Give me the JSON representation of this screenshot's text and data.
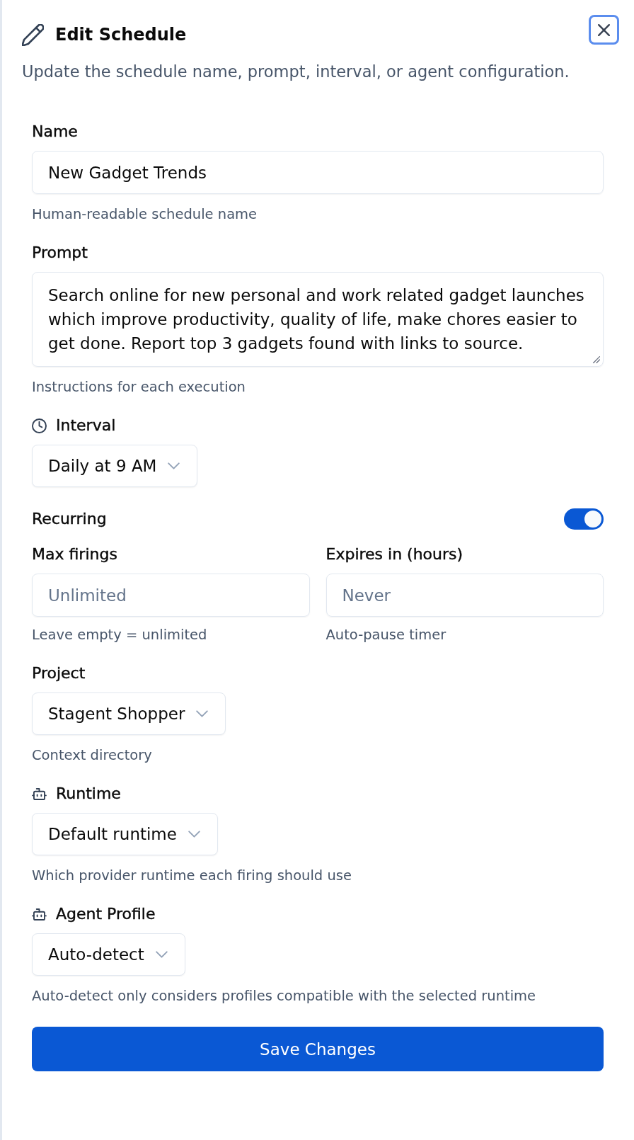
{
  "dialog": {
    "title": "Edit Schedule",
    "subtitle": "Update the schedule name, prompt, interval, or agent configuration."
  },
  "fields": [
    {
      "kind": "text",
      "label": "Name",
      "value": "New Gadget Trends",
      "hint": "Human-readable schedule name"
    },
    {
      "kind": "textarea",
      "label": "Prompt",
      "value": "Search online for new personal and work related gadget launches which improve productivity, quality of life, make chores easier to get done. Report top 3 gadgets found with links to source.",
      "hint": "Instructions for each execution"
    },
    {
      "kind": "interval",
      "label": "Interval",
      "value": "Daily at 9 AM"
    },
    {
      "kind": "toggle",
      "label": "Recurring",
      "on": true
    },
    {
      "kind": "pair",
      "items": [
        {
          "label": "Max firings",
          "placeholder": "Unlimited",
          "hint": "Leave empty = unlimited"
        },
        {
          "label": "Expires in (hours)",
          "placeholder": "Never",
          "hint": "Auto-pause timer"
        }
      ]
    },
    {
      "kind": "select",
      "label": "Project",
      "value": "Stagent Shopper",
      "hint": "Context directory"
    },
    {
      "kind": "agent",
      "label": "Runtime",
      "value": "Default runtime",
      "hint": "Which provider runtime each firing should use"
    },
    {
      "kind": "agent",
      "label": "Agent Profile",
      "value": "Auto-detect",
      "hint": "Auto-detect only considers profiles compatible with the selected runtime"
    }
  ],
  "save_button": "Save Changes"
}
